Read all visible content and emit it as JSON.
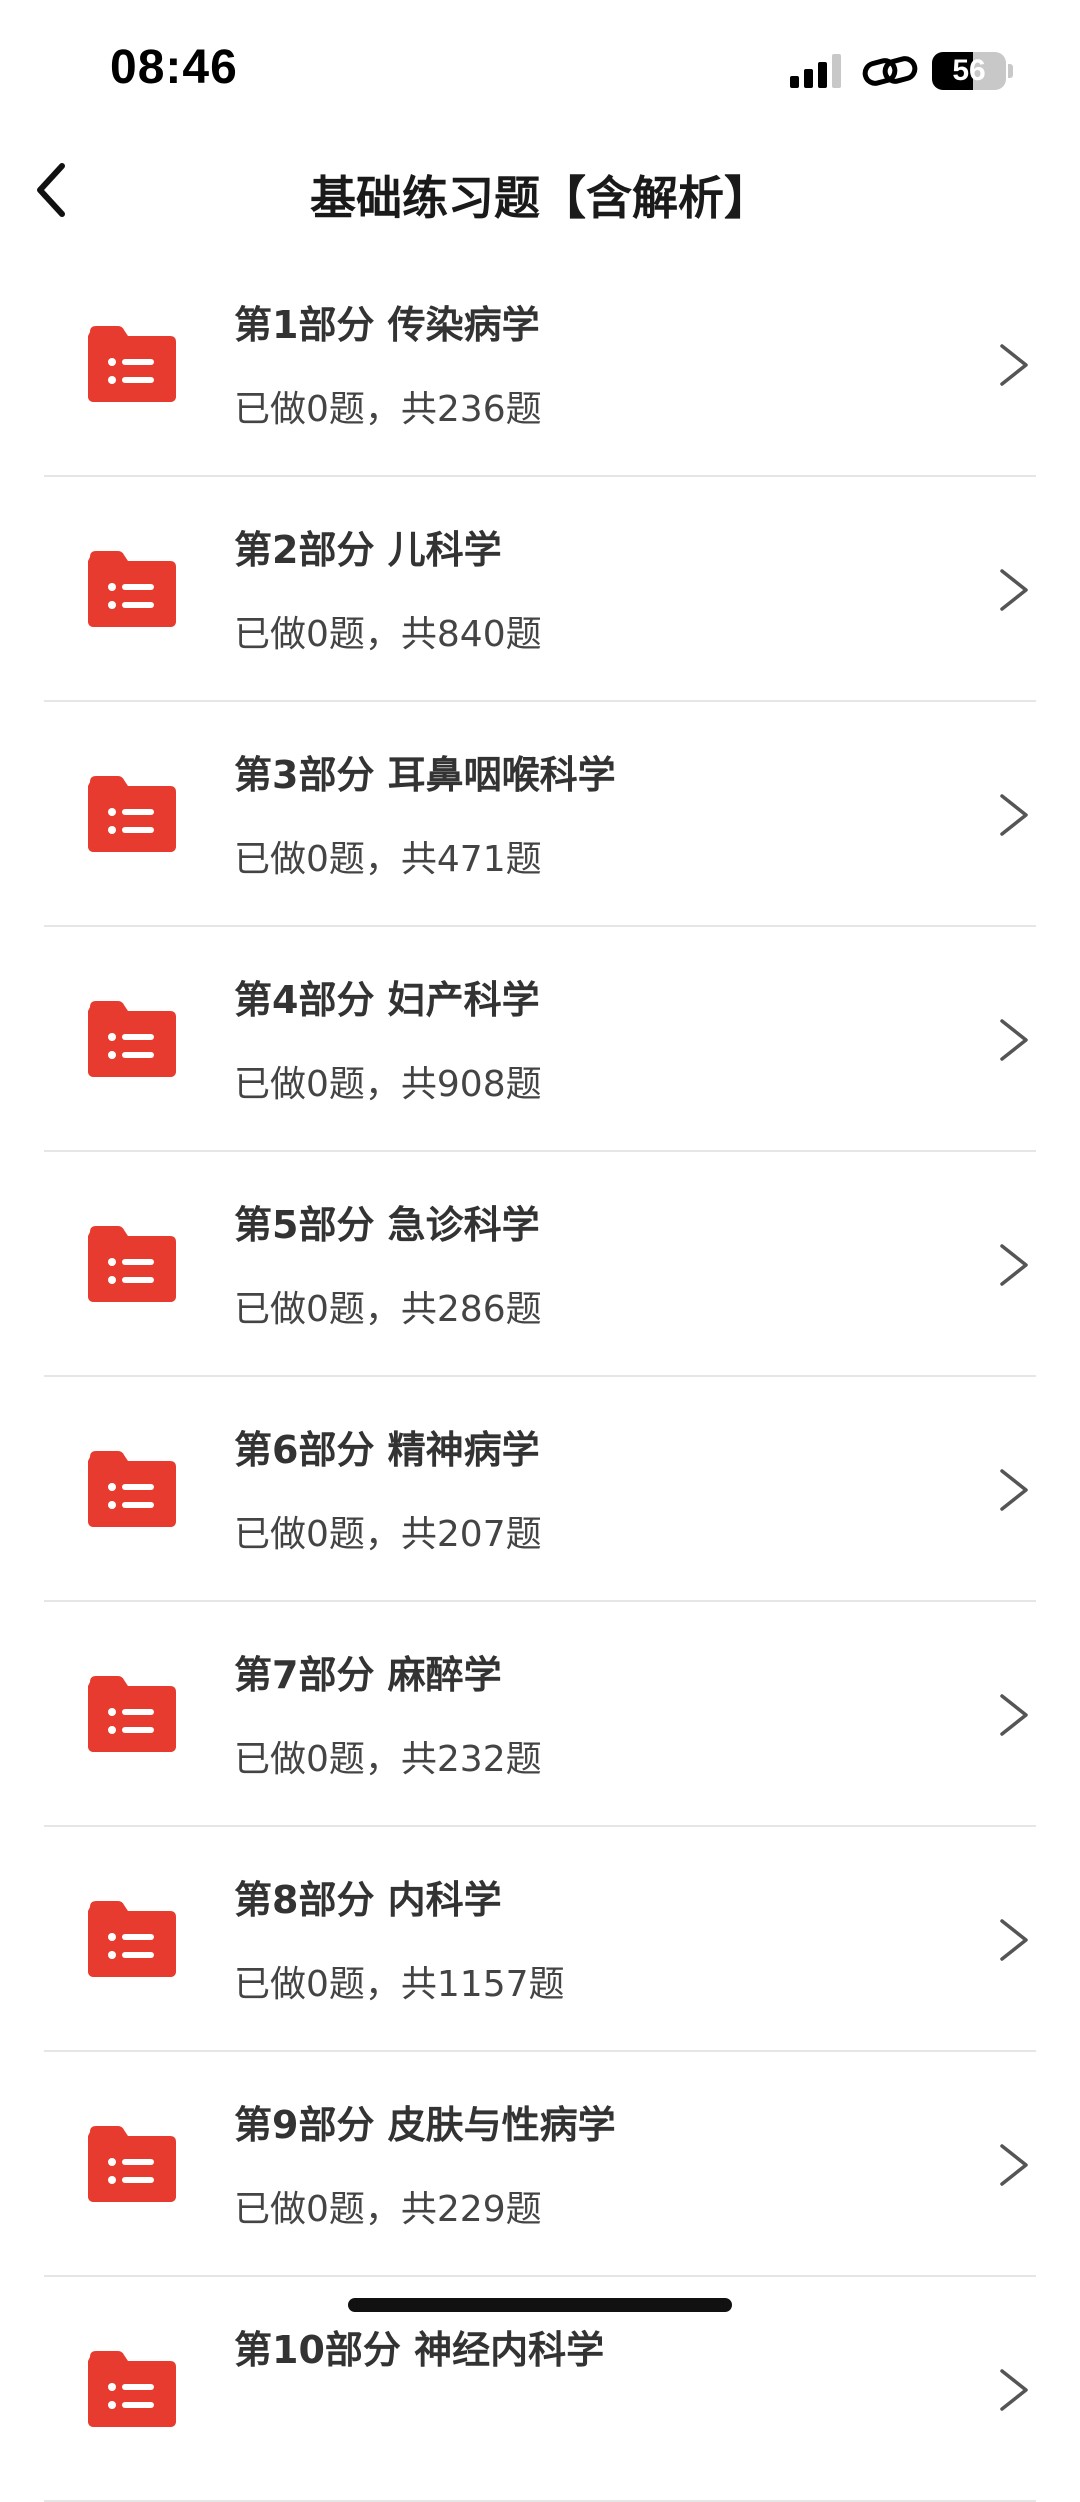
{
  "status_bar": {
    "time": "08:46",
    "battery_level": "56"
  },
  "header": {
    "title": "基础练习题【含解析】"
  },
  "accent_color": "#e63b2e",
  "items": [
    {
      "title": "第1部分 传染病学",
      "subtitle": "已做0题，共236题"
    },
    {
      "title": "第2部分 儿科学",
      "subtitle": "已做0题，共840题"
    },
    {
      "title": "第3部分 耳鼻咽喉科学",
      "subtitle": "已做0题，共471题"
    },
    {
      "title": "第4部分 妇产科学",
      "subtitle": "已做0题，共908题"
    },
    {
      "title": "第5部分 急诊科学",
      "subtitle": "已做0题，共286题"
    },
    {
      "title": "第6部分 精神病学",
      "subtitle": "已做0题，共207题"
    },
    {
      "title": "第7部分 麻醉学",
      "subtitle": "已做0题，共232题"
    },
    {
      "title": "第8部分 内科学",
      "subtitle": "已做0题，共1157题"
    },
    {
      "title": "第9部分 皮肤与性病学",
      "subtitle": "已做0题，共229题"
    },
    {
      "title": "第10部分 神经内科学",
      "subtitle": ""
    }
  ]
}
